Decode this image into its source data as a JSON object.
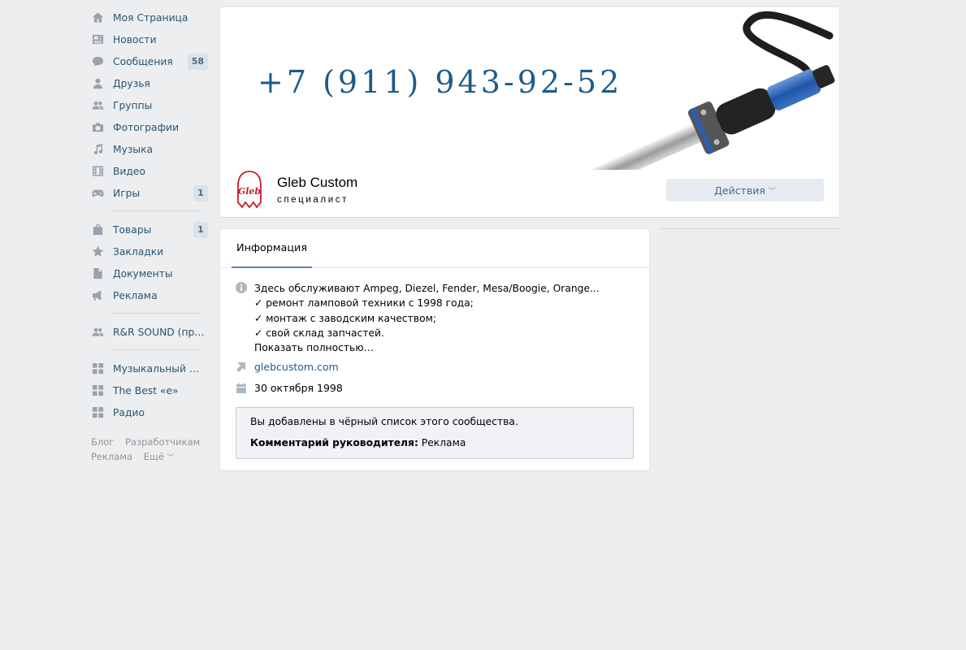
{
  "sidebar": {
    "items": [
      {
        "label": "Моя Страница",
        "icon": "home-icon"
      },
      {
        "label": "Новости",
        "icon": "news-icon"
      },
      {
        "label": "Сообщения",
        "icon": "messages-icon",
        "count": "58"
      },
      {
        "label": "Друзья",
        "icon": "user-icon"
      },
      {
        "label": "Группы",
        "icon": "groups-icon"
      },
      {
        "label": "Фотографии",
        "icon": "camera-icon"
      },
      {
        "label": "Музыка",
        "icon": "music-note-icon"
      },
      {
        "label": "Видео",
        "icon": "film-icon"
      },
      {
        "label": "Игры",
        "icon": "gamepad-icon",
        "count": "1"
      }
    ],
    "items2": [
      {
        "label": "Товары",
        "icon": "shopping-bag-icon",
        "count": "1"
      },
      {
        "label": "Закладки",
        "icon": "star-icon"
      },
      {
        "label": "Документы",
        "icon": "document-icon"
      },
      {
        "label": "Реклама",
        "icon": "megaphone-icon"
      }
    ],
    "items3": [
      {
        "label": "R&R SOUND (прои...",
        "icon": "groups-icon"
      }
    ],
    "items4": [
      {
        "label": "Музыкальный Пле...",
        "icon": "app-grid-icon"
      },
      {
        "label": "The Best «e»",
        "icon": "app-grid-icon"
      },
      {
        "label": "Радио",
        "icon": "app-grid-icon"
      }
    ],
    "footer": [
      "Блог",
      "Разработчикам",
      "Реклама",
      "Ещё"
    ]
  },
  "cover": {
    "phone": "+7 (911) 943-92-52",
    "avatar_text": "Gleb",
    "group_name": "Gleb Custom",
    "group_status": "специалист",
    "actions_label": "Действия"
  },
  "info": {
    "tab": "Информация",
    "description": [
      "Здесь обслуживают Ampeg, Diezel, Fender, Mesa/Boogie, Orange...",
      "✓ ремонт ламповой техники с 1998 года;",
      "✓ монтаж с заводским качеством;",
      "✓ свой склад запчастей."
    ],
    "show_more": "Показать полностью…",
    "website": "glebcustom.com",
    "date": "30 октября 1998",
    "notice": {
      "text": "Вы добавлены в чёрный список этого сообщества.",
      "comment_label": "Комментарий руководителя:",
      "comment_value": "Реклама"
    }
  },
  "colors": {
    "background": "#edeef0",
    "link": "#2a5885",
    "accent": "#5181b8",
    "phone": "#1c5b8a",
    "icon": "#99a2ad"
  }
}
